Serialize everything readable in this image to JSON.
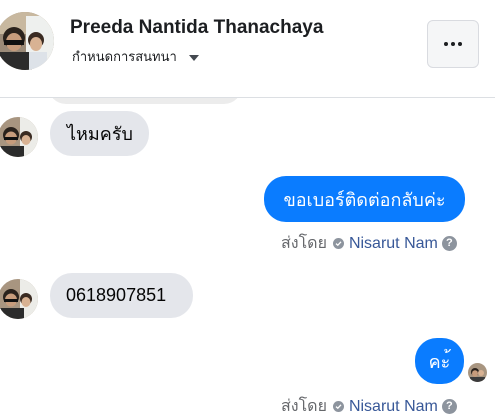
{
  "header": {
    "contact_name": "Preeda Nantida Thanachaya",
    "subtitle": "กำหนดการสนทนา"
  },
  "icons": {
    "avatar": "profile-photo",
    "caret": "caret-down-icon",
    "more": "more-horizontal-icon",
    "verified": "check-circle-icon",
    "help": "question-icon"
  },
  "colors": {
    "outgoing_bubble": "#0a7cff",
    "incoming_bubble": "#e4e6eb",
    "sender_name": "#385898",
    "meta_text": "#65676b"
  },
  "messages": [
    {
      "direction": "in",
      "text": "ไหมครับ"
    },
    {
      "direction": "out",
      "text": "ขอเบอร์ติดต่อกลับค่ะ",
      "sent_by_label": "ส่งโดย",
      "sender": "Nisarut Nam"
    },
    {
      "direction": "in",
      "text": "0618907851"
    },
    {
      "direction": "out",
      "text": "คะ้",
      "sent_by_label": "ส่งโดย",
      "sender": "Nisarut Nam"
    }
  ]
}
